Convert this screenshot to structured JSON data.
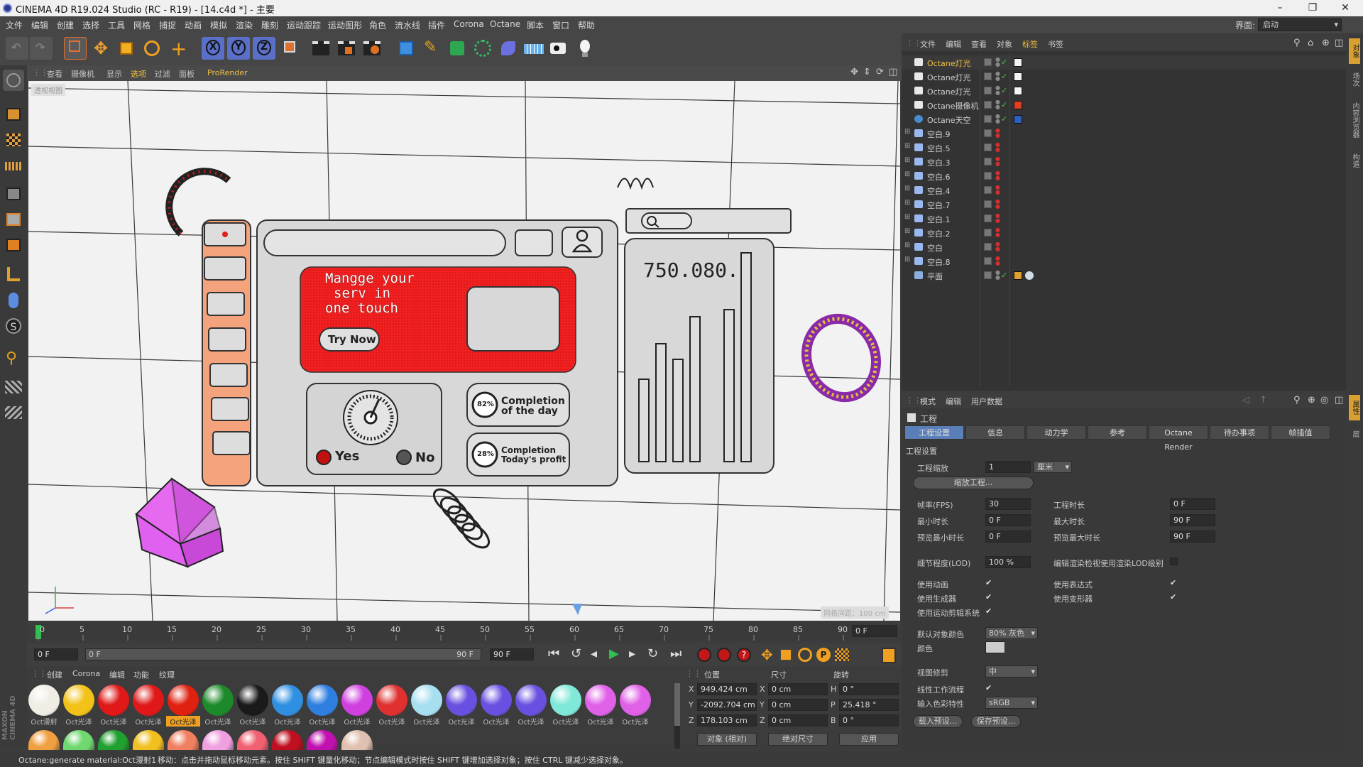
{
  "window": {
    "title": "CINEMA 4D R19.024 Studio (RC - R19) - [14.c4d *] - 主要",
    "min": "–",
    "max": "❐",
    "close": "✕"
  },
  "menu": [
    "文件",
    "编辑",
    "创建",
    "选择",
    "工具",
    "网格",
    "捕捉",
    "动画",
    "模拟",
    "渲染",
    "雕刻",
    "运动跟踪",
    "运动图形",
    "角色",
    "流水线",
    "插件",
    "Corona",
    "Octane",
    "脚本",
    "窗口",
    "帮助"
  ],
  "layout": {
    "label": "界面:",
    "value": "启动"
  },
  "viewport_menu": [
    "查看",
    "摄像机",
    "显示",
    "选项",
    "过滤",
    "面板",
    "ProRender"
  ],
  "viewport_label": "透视视图",
  "grid_distance": "网格间距：100 cm",
  "scene": {
    "headline": [
      "Mangge your",
      "serv  in",
      "one  touch"
    ],
    "try_now": "Try  Now",
    "yes": "Yes",
    "no": "No",
    "stat1_pct": "82%",
    "stat1_text": [
      "Completion",
      "of the day"
    ],
    "stat2_pct": "28%",
    "stat2_text": [
      "Completion",
      "Today's profit"
    ],
    "big_number": "750.080."
  },
  "timeline": {
    "ticks": [
      "0",
      "5",
      "10",
      "15",
      "20",
      "25",
      "30",
      "35",
      "40",
      "45",
      "50",
      "55",
      "60",
      "65",
      "70",
      "75",
      "80",
      "85",
      "90"
    ],
    "end_frame": "0 F"
  },
  "transport": {
    "start": "0 F",
    "range_start": "0 F",
    "range_end": "90 F",
    "end": "90 F"
  },
  "materials": {
    "menu": [
      "创建",
      "Corona",
      "编辑",
      "功能",
      "纹理"
    ],
    "row1": [
      {
        "label": "Oct漫射",
        "color": "#f0ede4"
      },
      {
        "label": "Oct光泽",
        "color": "#f2c218"
      },
      {
        "label": "Oct光泽",
        "color": "#e01818"
      },
      {
        "label": "Oct光泽",
        "color": "#e01818"
      },
      {
        "label": "Oct光泽",
        "color": "#e02010"
      },
      {
        "label": "Oct光泽",
        "color": "#1c8a2a"
      },
      {
        "label": "Oct光泽",
        "color": "#1a1a1a"
      },
      {
        "label": "Oct光泽",
        "color": "#2f8fe0"
      },
      {
        "label": "Oct光泽",
        "color": "#2f7fe0"
      },
      {
        "label": "Oct光泽",
        "color": "#d040e0"
      },
      {
        "label": "Oct光泽",
        "color": "#e03030"
      },
      {
        "label": "Oct光泽",
        "color": "#a8dff0"
      },
      {
        "label": "Oct光泽",
        "color": "#6a50e0"
      },
      {
        "label": "Oct光泽",
        "color": "#6a50e0"
      },
      {
        "label": "Oct光泽",
        "color": "#6a50e0"
      },
      {
        "label": "Oct光泽",
        "color": "#80e8d8"
      },
      {
        "label": "Oct光泽",
        "color": "#e060e8"
      },
      {
        "label": "Oct光泽",
        "color": "#e060e8"
      }
    ],
    "row2_colors": [
      "#f0a040",
      "#70d870",
      "#20a030",
      "#f0c020",
      "#f08060",
      "#f0a0e0",
      "#f06070",
      "#c01020",
      "#c010b0",
      "#e0c0b0"
    ]
  },
  "coords": {
    "headers": [
      "位置",
      "尺寸",
      "旋转"
    ],
    "x": {
      "pos": "949.424 cm",
      "size": "0 cm",
      "rot": "0 °",
      "size_label": "X",
      "rot_label": "H"
    },
    "y": {
      "pos": "-2092.704 cm",
      "size": "0 cm",
      "rot": "25.418 °",
      "size_label": "Y",
      "rot_label": "P"
    },
    "z": {
      "pos": "178.103 cm",
      "size": "0 cm",
      "rot": "0 °",
      "size_label": "Z",
      "rot_label": "B"
    },
    "mode": "对象 (相对)",
    "size_mode": "绝对尺寸",
    "apply": "应用"
  },
  "object_manager": {
    "menu": [
      "文件",
      "编辑",
      "查看",
      "对象",
      "标签",
      "书签"
    ],
    "objects": [
      {
        "name": "Octane灯光",
        "type": "light",
        "active": true
      },
      {
        "name": "Octane灯光",
        "type": "light",
        "active": false
      },
      {
        "name": "Octane灯光",
        "type": "light",
        "active": false
      },
      {
        "name": "Octane摄像机",
        "type": "camera",
        "active": false
      },
      {
        "name": "Octane天空",
        "type": "sky",
        "active": false
      },
      {
        "name": "空白.9",
        "type": "null",
        "active": false
      },
      {
        "name": "空白.5",
        "type": "null",
        "active": false
      },
      {
        "name": "空白.3",
        "type": "null",
        "active": false
      },
      {
        "name": "空白.6",
        "type": "null",
        "active": false
      },
      {
        "name": "空白.4",
        "type": "null",
        "active": false
      },
      {
        "name": "空白.7",
        "type": "null",
        "active": false
      },
      {
        "name": "空白.1",
        "type": "null",
        "active": false
      },
      {
        "name": "空白.2",
        "type": "null",
        "active": false
      },
      {
        "name": "空白",
        "type": "null",
        "active": false
      },
      {
        "name": "空白.8",
        "type": "null",
        "active": false
      },
      {
        "name": "平面",
        "type": "plane",
        "active": false
      }
    ]
  },
  "attributes": {
    "menu": [
      "模式",
      "编辑",
      "用户数据"
    ],
    "section": "工程",
    "tabs": [
      "工程设置",
      "信息",
      "动力学",
      "参考",
      "Octane Render",
      "待办事项",
      "帧插值"
    ],
    "group": "工程设置",
    "scale_label": "工程缩放",
    "scale_value": "1",
    "scale_unit": "厘米",
    "scale_button": "缩放工程...",
    "fps_label": "帧率(FPS)",
    "fps": "30",
    "time_label": "工程时长",
    "time": "0 F",
    "min_label": "最小时长",
    "min": "0 F",
    "max_label": "最大时长",
    "max": "90 F",
    "pmin_label": "预览最小时长",
    "pmin": "0 F",
    "pmax_label": "预览最大时长",
    "pmax": "90 F",
    "lod_label": "细节程度(LOD)",
    "lod": "100 %",
    "lod_render_label": "编辑渲染检视使用渲染LOD级别",
    "anim_label": "使用动画",
    "expr_label": "使用表达式",
    "gen_label": "使用生成器",
    "deform_label": "使用变形器",
    "motion_label": "使用运动剪辑系统",
    "defcolor_label": "默认对象颜色",
    "defcolor": "80% 灰色",
    "color_label": "颜色",
    "clip_label": "视图修剪",
    "clip": "中",
    "linear_label": "线性工作流程",
    "input_color_label": "输入色彩特性",
    "input_color": "sRGB",
    "load_preset": "载入预设...",
    "save_preset": "保存预设..."
  },
  "status": "Octane:generate material:Oct漫射1",
  "status_hint": "移动：点击并拖动鼠标移动元素。按住 SHIFT 键量化移动；节点编辑模式时按住 SHIFT 键增加选择对象；按住 CTRL 键减少选择对象。",
  "right_strip": [
    "对象",
    "场次",
    "内容浏览器",
    "构造"
  ],
  "right_strip2": [
    "属性",
    "层"
  ]
}
